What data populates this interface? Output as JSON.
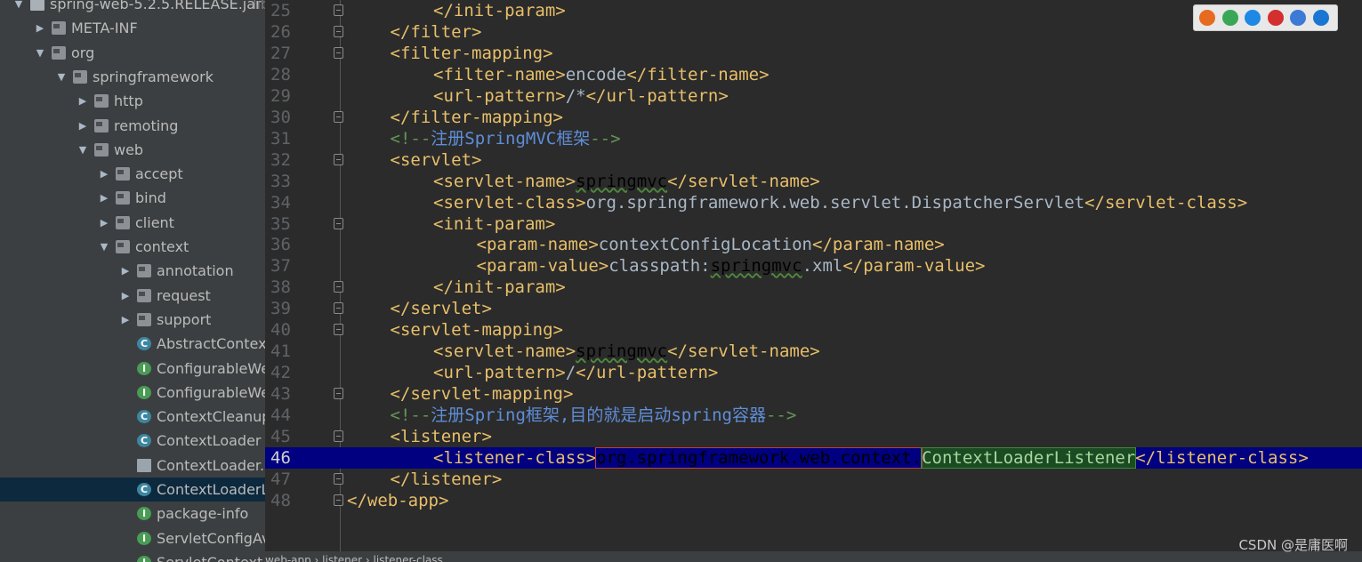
{
  "project_tree": {
    "items": [
      {
        "label": "spring-web-5.2.5.RELEASE.jar",
        "suffix": "lib",
        "icon": "jar-icon",
        "expanded": true
      },
      {
        "label": "META-INF",
        "icon": "package-icon",
        "expanded": false
      },
      {
        "label": "org",
        "icon": "package-icon",
        "expanded": true
      },
      {
        "label": "springframework",
        "icon": "package-icon",
        "expanded": true
      },
      {
        "label": "http",
        "icon": "package-icon",
        "expanded": false
      },
      {
        "label": "remoting",
        "icon": "package-icon",
        "expanded": false
      },
      {
        "label": "web",
        "icon": "package-icon",
        "expanded": true
      },
      {
        "label": "accept",
        "icon": "package-icon",
        "expanded": false
      },
      {
        "label": "bind",
        "icon": "package-icon",
        "expanded": false
      },
      {
        "label": "client",
        "icon": "package-icon",
        "expanded": false
      },
      {
        "label": "context",
        "icon": "package-icon",
        "expanded": true
      },
      {
        "label": "annotation",
        "icon": "package-icon",
        "expanded": false
      },
      {
        "label": "request",
        "icon": "package-icon",
        "expanded": false
      },
      {
        "label": "support",
        "icon": "package-icon",
        "expanded": false
      },
      {
        "label": "AbstractContext",
        "icon": "class-icon"
      },
      {
        "label": "ConfigurableWe",
        "icon": "interface-icon"
      },
      {
        "label": "ConfigurableWe",
        "icon": "interface-icon"
      },
      {
        "label": "ContextCleanup",
        "icon": "class-icon"
      },
      {
        "label": "ContextLoader",
        "icon": "class-icon"
      },
      {
        "label": "ContextLoader.p",
        "icon": "properties-file-icon"
      },
      {
        "label": "ContextLoaderL",
        "icon": "class-icon",
        "selected": true
      },
      {
        "label": "package-info",
        "icon": "interface-icon"
      },
      {
        "label": "ServletConfigAv",
        "icon": "interface-icon"
      },
      {
        "label": "ServletContextA",
        "icon": "interface-icon"
      }
    ]
  },
  "editor": {
    "current_line": 46,
    "lines": [
      {
        "num": "25",
        "indent": 2,
        "parts": [
          {
            "t": "tag",
            "v": "</init-param>"
          }
        ]
      },
      {
        "num": "26",
        "indent": 1,
        "parts": [
          {
            "t": "tag",
            "v": "</filter>"
          }
        ]
      },
      {
        "num": "27",
        "indent": 1,
        "parts": [
          {
            "t": "tag",
            "v": "<filter-mapping>"
          }
        ]
      },
      {
        "num": "28",
        "indent": 2,
        "parts": [
          {
            "t": "tag",
            "v": "<filter-name>"
          },
          {
            "t": "txt",
            "v": "encode"
          },
          {
            "t": "tag",
            "v": "</filter-name>"
          }
        ]
      },
      {
        "num": "29",
        "indent": 2,
        "parts": [
          {
            "t": "tag",
            "v": "<url-pattern>"
          },
          {
            "t": "txt",
            "v": "/*"
          },
          {
            "t": "tag",
            "v": "</url-pattern>"
          }
        ]
      },
      {
        "num": "30",
        "indent": 1,
        "parts": [
          {
            "t": "tag",
            "v": "</filter-mapping>"
          }
        ]
      },
      {
        "num": "31",
        "indent": 1,
        "parts": [
          {
            "t": "cmt",
            "v": "<!--"
          },
          {
            "t": "cmt2",
            "v": "注册SpringMVC框架"
          },
          {
            "t": "cmt",
            "v": "-->"
          }
        ]
      },
      {
        "num": "32",
        "indent": 1,
        "parts": [
          {
            "t": "tag",
            "v": "<servlet>"
          }
        ]
      },
      {
        "num": "33",
        "indent": 2,
        "parts": [
          {
            "t": "tag",
            "v": "<servlet-name>"
          },
          {
            "t": "squig",
            "v": "springmvc"
          },
          {
            "t": "tag",
            "v": "</servlet-name>"
          }
        ]
      },
      {
        "num": "34",
        "indent": 2,
        "parts": [
          {
            "t": "tag",
            "v": "<servlet-class>"
          },
          {
            "t": "txt",
            "v": "org.springframework.web.servlet.DispatcherServlet"
          },
          {
            "t": "tag",
            "v": "</servlet-class>"
          }
        ]
      },
      {
        "num": "35",
        "indent": 2,
        "parts": [
          {
            "t": "tag",
            "v": "<init-param>"
          }
        ]
      },
      {
        "num": "36",
        "indent": 3,
        "parts": [
          {
            "t": "tag",
            "v": "<param-name>"
          },
          {
            "t": "txt",
            "v": "contextConfigLocation"
          },
          {
            "t": "tag",
            "v": "</param-name>"
          }
        ]
      },
      {
        "num": "37",
        "indent": 3,
        "parts": [
          {
            "t": "tag",
            "v": "<param-value>"
          },
          {
            "t": "txt",
            "v": "classpath:"
          },
          {
            "t": "squig",
            "v": "springmvc"
          },
          {
            "t": "txt",
            "v": ".xml"
          },
          {
            "t": "tag",
            "v": "</param-value>"
          }
        ]
      },
      {
        "num": "38",
        "indent": 2,
        "parts": [
          {
            "t": "tag",
            "v": "</init-param>"
          }
        ]
      },
      {
        "num": "39",
        "indent": 1,
        "parts": [
          {
            "t": "tag",
            "v": "</servlet>"
          }
        ]
      },
      {
        "num": "40",
        "indent": 1,
        "parts": [
          {
            "t": "tag",
            "v": "<servlet-mapping>"
          }
        ]
      },
      {
        "num": "41",
        "indent": 2,
        "parts": [
          {
            "t": "tag",
            "v": "<servlet-name>"
          },
          {
            "t": "squig",
            "v": "springmvc"
          },
          {
            "t": "tag",
            "v": "</servlet-name>"
          }
        ]
      },
      {
        "num": "42",
        "indent": 2,
        "parts": [
          {
            "t": "tag",
            "v": "<url-pattern>"
          },
          {
            "t": "txt",
            "v": "/"
          },
          {
            "t": "tag",
            "v": "</url-pattern>"
          }
        ]
      },
      {
        "num": "43",
        "indent": 1,
        "parts": [
          {
            "t": "tag",
            "v": "</servlet-mapping>"
          }
        ]
      },
      {
        "num": "44",
        "indent": 1,
        "parts": [
          {
            "t": "cmt",
            "v": "<!--"
          },
          {
            "t": "cmt2",
            "v": "注册Spring框架,目的就是启动spring容器"
          },
          {
            "t": "cmt",
            "v": "-->"
          }
        ]
      },
      {
        "num": "45",
        "indent": 1,
        "parts": [
          {
            "t": "tag",
            "v": "<listener>"
          }
        ]
      },
      {
        "num": "46",
        "indent": 2,
        "parts": [
          {
            "t": "tag",
            "v": "<listener-class>"
          },
          {
            "t": "boxed-red",
            "v": "org.springframework.web.context."
          },
          {
            "t": "boxed-green",
            "v": "ContextLoaderListener"
          },
          {
            "t": "tag",
            "v": "</listener-class>"
          }
        ]
      },
      {
        "num": "47",
        "indent": 1,
        "parts": [
          {
            "t": "tag",
            "v": "</listener>"
          }
        ]
      },
      {
        "num": "48",
        "indent": 0,
        "parts": [
          {
            "t": "tag",
            "v": "</web-app>"
          }
        ]
      }
    ]
  },
  "breadcrumb": "web-app  ›  listener  ›  listener-class",
  "browser_icons": [
    "firefox-icon",
    "chrome-icon",
    "safari-icon",
    "opera-icon",
    "ie-icon",
    "edge-icon"
  ],
  "browser_colors": [
    "#e66a1f",
    "#3aa757",
    "#1e88e5",
    "#d32f2f",
    "#3b7bd6",
    "#1976d2"
  ],
  "watermark": "CSDN @是庸医啊"
}
